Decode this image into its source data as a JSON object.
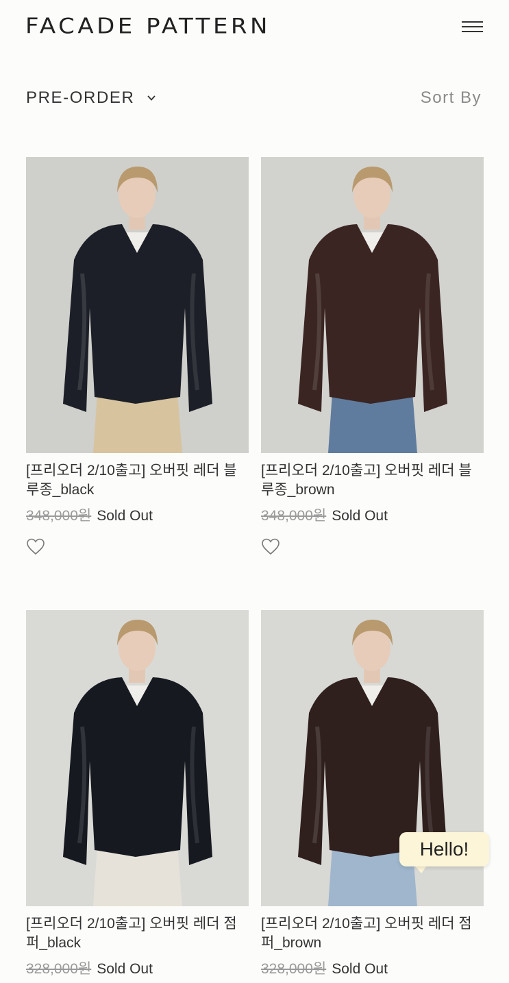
{
  "header": {
    "brand": "FACADE PATTERN",
    "menu_icon": "hamburger-menu-icon"
  },
  "filter": {
    "category": "PRE-ORDER",
    "sort_label": "Sort By"
  },
  "products": [
    {
      "name": "[프리오더 2/10출고] 오버핏 레더 블루종_black",
      "original_price": "348,000원",
      "status": "Sold Out",
      "jacket_color": "#1c1f27",
      "bottom_color": "#d7c49f",
      "bg": "#cfcfcb"
    },
    {
      "name": "[프리오더 2/10출고] 오버핏 레더 블루종_brown",
      "original_price": "348,000원",
      "status": "Sold Out",
      "jacket_color": "#3a2522",
      "bottom_color": "#5f7c9e",
      "bg": "#d2d2ce"
    },
    {
      "name": "[프리오더 2/10출고] 오버핏 레더 점퍼_black",
      "original_price": "328,000원",
      "status": "Sold Out",
      "jacket_color": "#161920",
      "bottom_color": "#e6e2d9",
      "bg": "#d9dad6"
    },
    {
      "name": "[프리오더 2/10출고] 오버핏 레더 점퍼_brown",
      "original_price": "328,000원",
      "status": "Sold Out",
      "jacket_color": "#2f201d",
      "bottom_color": "#9fb6cc",
      "bg": "#d8d8d4"
    }
  ],
  "chat": {
    "label": "Hello!"
  }
}
